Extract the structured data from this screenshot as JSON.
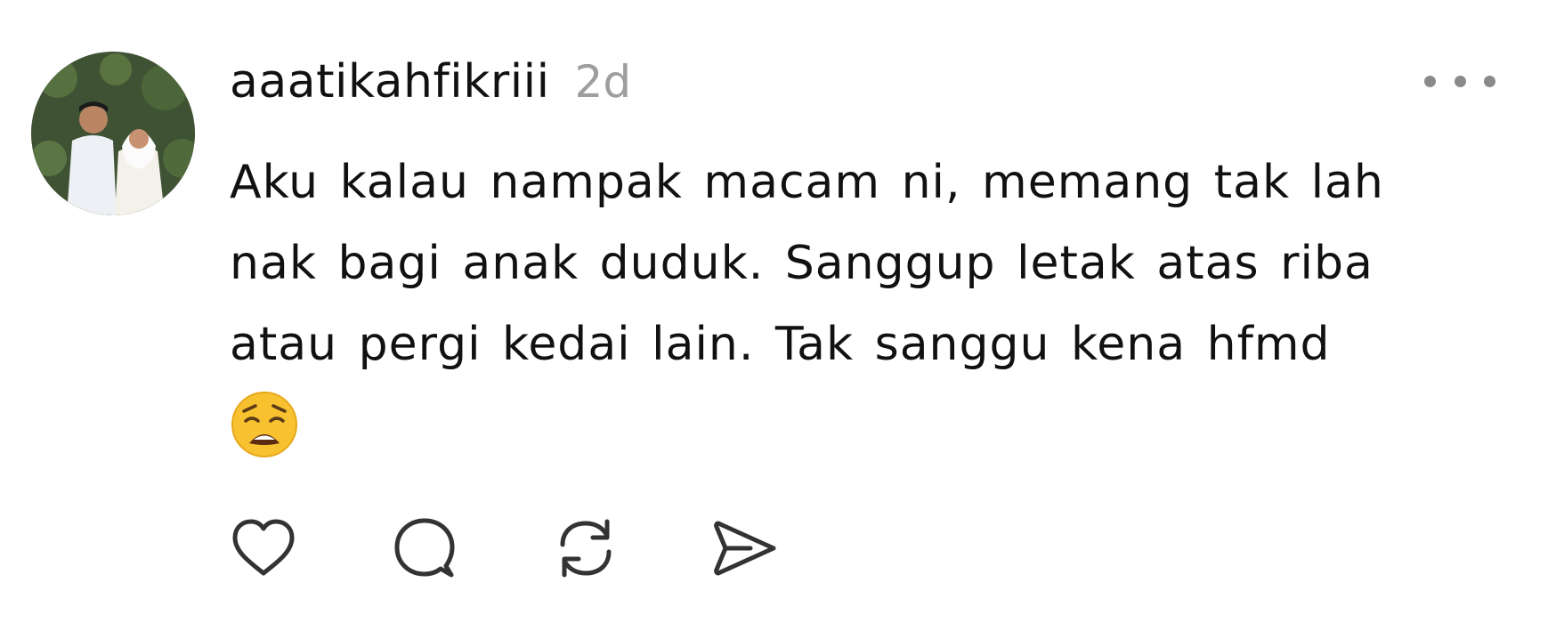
{
  "post": {
    "username": "aaatikahfikriii",
    "timestamp": "2d",
    "text": "Aku kalau nampak macam ni, memang tak lah nak bagi anak duduk. Sanggup letak atas riba atau pergi kedai lain. Tak sanggu kena hfmd",
    "emoji": "weary-face",
    "avatar": "couple-photo"
  },
  "icons": {
    "more": "more-horizontal-icon",
    "like": "heart-icon",
    "comment": "comment-bubble-icon",
    "repost": "repost-icon",
    "share": "send-icon"
  },
  "colors": {
    "text": "#111111",
    "timestamp": "#9e9e9e",
    "icon": "#333333",
    "emoji": "#f7c12f"
  }
}
